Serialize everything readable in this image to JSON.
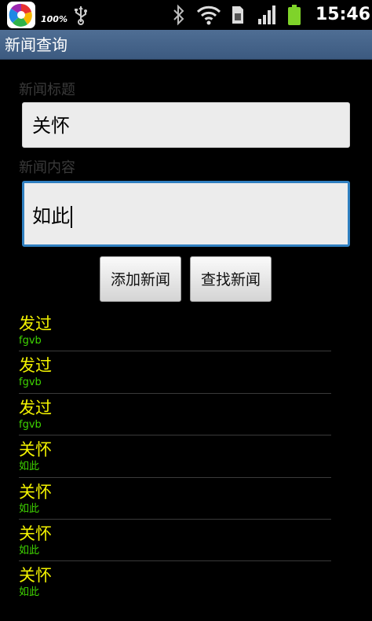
{
  "status_bar": {
    "battery_percent": "100%",
    "time": "15:46",
    "icons": [
      "app-launcher-icon",
      "usb-icon",
      "bluetooth-icon",
      "wifi-icon",
      "sim-icon",
      "signal-icon",
      "battery-icon"
    ]
  },
  "titlebar": {
    "title": "新闻查询"
  },
  "form": {
    "title_label": "新闻标题",
    "title_value": "关怀",
    "content_label": "新闻内容",
    "content_value": "如此",
    "add_button": "添加新闻",
    "find_button": "查找新闻"
  },
  "news_list": [
    {
      "title": "发过",
      "content": "fgvb"
    },
    {
      "title": "发过",
      "content": "fgvb"
    },
    {
      "title": "发过",
      "content": "fgvb"
    },
    {
      "title": "关怀",
      "content": "如此"
    },
    {
      "title": "关怀",
      "content": "如此"
    },
    {
      "title": "关怀",
      "content": "如此"
    },
    {
      "title": "关怀",
      "content": "如此"
    }
  ],
  "colors": {
    "title_text": "#f2f200",
    "content_text": "#3fd400",
    "focus_border": "#2f7fc0",
    "titlebar_bg": "#4f6e94"
  }
}
